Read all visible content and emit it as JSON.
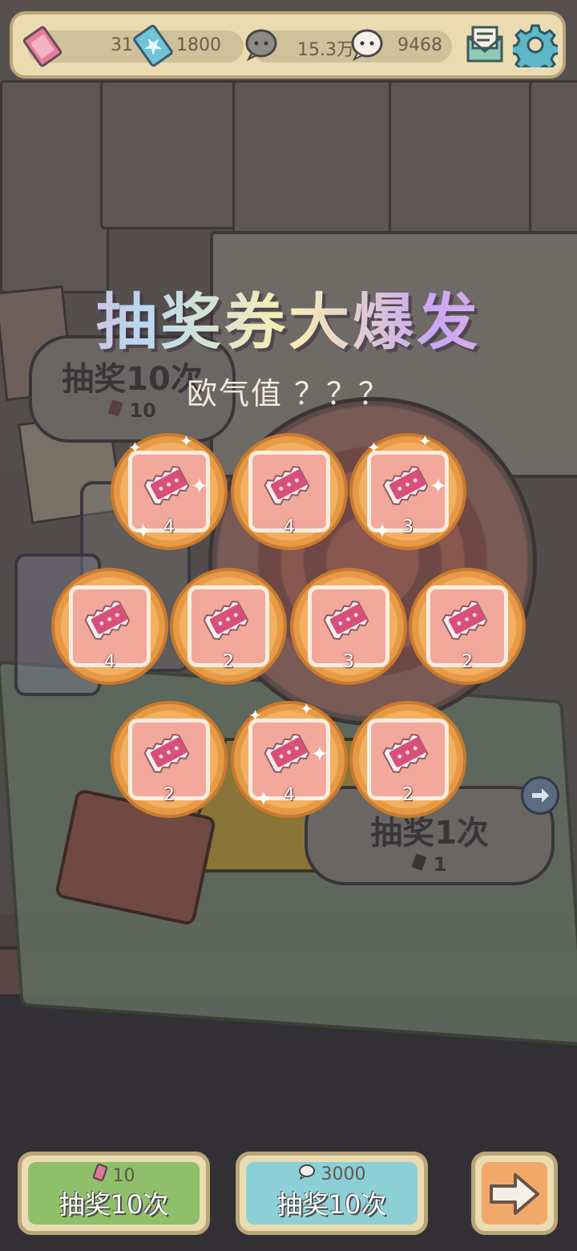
{
  "resources": {
    "tickets": "31",
    "star_tickets": "1800",
    "gray_bubbles": "15.3万",
    "white_bubbles": "9468"
  },
  "icons": {
    "ticket": "ticket-icon",
    "star_ticket": "star-ticket-icon",
    "gray_bubble": "gray-bubble-icon",
    "white_bubble": "white-bubble-icon",
    "mail": "mail-icon",
    "settings": "gear-icon"
  },
  "title": "抽奖券大爆发",
  "subtitle": "欧气值 ？？？",
  "rewards": [
    {
      "count": "4",
      "sparkle": true
    },
    {
      "count": "4",
      "sparkle": false
    },
    {
      "count": "3",
      "sparkle": true
    },
    {
      "count": "4",
      "sparkle": false
    },
    {
      "count": "2",
      "sparkle": false
    },
    {
      "count": "3",
      "sparkle": false
    },
    {
      "count": "2",
      "sparkle": false
    },
    {
      "count": "2",
      "sparkle": false
    },
    {
      "count": "4",
      "sparkle": true
    },
    {
      "count": "2",
      "sparkle": false
    }
  ],
  "background_buttons": {
    "draw10": {
      "label": "抽奖10次",
      "cost": "10"
    },
    "draw1": {
      "label": "抽奖1次",
      "cost": "1"
    }
  },
  "bottom": {
    "ticket_draw": {
      "cost": "10",
      "label": "抽奖10次"
    },
    "bubble_draw": {
      "cost": "3000",
      "label": "抽奖10次"
    }
  },
  "colors": {
    "orange": "#f3b061",
    "card": "#f2a89a",
    "green_button": "#8fbf6a",
    "blue_button": "#8ccfd6",
    "panel": "#eadcb0"
  }
}
